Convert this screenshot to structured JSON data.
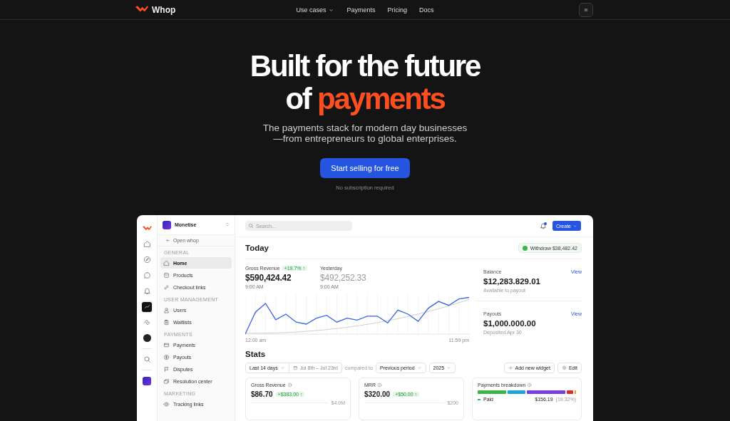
{
  "nav": {
    "brand": "Whop",
    "links": [
      {
        "label": "Use cases",
        "has_menu": true
      },
      {
        "label": "Payments",
        "has_menu": false
      },
      {
        "label": "Pricing",
        "has_menu": false
      },
      {
        "label": "Docs",
        "has_menu": false
      }
    ]
  },
  "hero": {
    "title": "Built for the future",
    "title_lead": "of",
    "title_highlight": "payments",
    "subtitle": "The payments stack for modern day businesses\n—from entrepreneurs to global enterprises.",
    "cta": "Start selling for free",
    "note": "No subscription required"
  },
  "dashboard": {
    "rail": [
      {
        "kind": "logo",
        "selected": false
      },
      {
        "kind": "home",
        "selected": false
      },
      {
        "kind": "compass",
        "selected": false
      },
      {
        "kind": "chat",
        "selected": false
      },
      {
        "kind": "bell",
        "selected": false
      },
      {
        "kind": "chart",
        "selected": true
      },
      {
        "kind": "ticket",
        "selected": false
      },
      {
        "kind": "avatar",
        "selected": false
      },
      {
        "kind": "search",
        "selected": false
      },
      {
        "kind": "app",
        "selected": false
      }
    ],
    "workspace": {
      "name": "Monetise",
      "back": "Open whop"
    },
    "sidebar": {
      "sections": [
        {
          "heading": "GENERAL",
          "items": [
            {
              "label": "Home",
              "selected": true
            },
            {
              "label": "Products",
              "selected": false
            },
            {
              "label": "Checkout links",
              "selected": false
            }
          ]
        },
        {
          "heading": "USER MANAGEMENT",
          "items": [
            {
              "label": "Users",
              "selected": false
            },
            {
              "label": "Waitlists",
              "selected": false
            }
          ]
        },
        {
          "heading": "PAYMENTS",
          "items": [
            {
              "label": "Payments",
              "selected": false
            },
            {
              "label": "Payouts",
              "selected": false
            },
            {
              "label": "Disputes",
              "selected": false
            },
            {
              "label": "Resolution center",
              "selected": false
            }
          ]
        },
        {
          "heading": "MARKETING",
          "items": [
            {
              "label": "Tracking links",
              "selected": false
            }
          ]
        }
      ]
    },
    "topbar": {
      "search_placeholder": "Search...",
      "notification": true,
      "create": "Create"
    },
    "today": {
      "heading": "Today",
      "withdraw": "Withdraw $38,482.42",
      "metrics": [
        {
          "kind": "current",
          "label": "Gross Revenue",
          "badge": "+19.7% ↑",
          "value": "$590,424.42",
          "time": "9:00 AM"
        },
        {
          "kind": "previous",
          "label": "Yesterday",
          "value": "$492,252.33",
          "time": "9:00 AM"
        }
      ],
      "chart_start": "12:00 am",
      "chart_end": "11:59 pm",
      "cards": [
        {
          "label": "Balance",
          "link": "View",
          "value": "$12,283.829.01",
          "note": "Available to payout"
        },
        {
          "label": "Payouts",
          "link": "View",
          "value": "$1,000.000.00",
          "note": "Deposited Apr 30"
        }
      ]
    },
    "stats": {
      "heading": "Stats",
      "range": "Last 14 days",
      "dates": "Jul 8th – Jul 23rd",
      "compared_label": "compared to",
      "compare": "Previous period",
      "year": "2025",
      "add_widget": "Add new widget",
      "edit": "Edit",
      "widgets": [
        {
          "kind": "metric",
          "title": "Gross Revenue",
          "value": "$86.70",
          "badge": "+$383.00 ↑",
          "tick": "$4.0M"
        },
        {
          "kind": "metric",
          "title": "MRR",
          "value": "$320.00",
          "badge": "+$50.00 ↑",
          "tick": "$200"
        },
        {
          "kind": "breakdown",
          "title": "Payments breakdown",
          "legend": [
            {
              "label": "Paid",
              "color": "#3bb54a",
              "amount": "$156.19",
              "share": "(19.32%)"
            }
          ]
        }
      ]
    }
  }
}
